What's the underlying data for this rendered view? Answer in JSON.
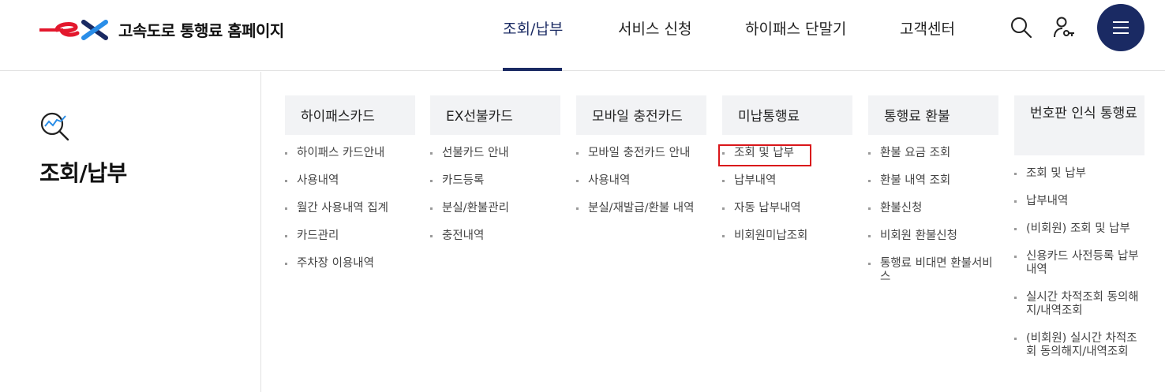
{
  "header": {
    "logo_text": "ex",
    "site_title": "고속도로 통행료 홈페이지",
    "nav": [
      "조회/납부",
      "서비스 신청",
      "하이패스 단말기",
      "고객센터"
    ],
    "active_nav": "조회/납부"
  },
  "icons": {
    "search": "search-icon",
    "user": "user-key-icon",
    "menu": "hamburger-menu-icon",
    "section": "magnifier-chart-icon"
  },
  "colors": {
    "brand_navy": "#1a2a63",
    "logo_red": "#e3182d",
    "highlight": "#d9161a"
  },
  "side": {
    "title": "조회/납부"
  },
  "columns": [
    {
      "title": "하이패스카드",
      "items": [
        "하이패스 카드안내",
        "사용내역",
        "월간 사용내역 집계",
        "카드관리",
        "주차장 이용내역"
      ]
    },
    {
      "title": "EX선불카드",
      "items": [
        "선불카드 안내",
        "카드등록",
        "분실/환불관리",
        "충전내역"
      ]
    },
    {
      "title": "모바일 충전카드",
      "items": [
        "모바일 충전카드 안내",
        "사용내역",
        "분실/재발급/환불 내역"
      ]
    },
    {
      "title": "미납통행료",
      "items": [
        "조회 및 납부",
        "납부내역",
        "자동 납부내역",
        "비회원미납조회"
      ]
    },
    {
      "title": "통행료 환불",
      "items": [
        "환불 요금 조회",
        "환불 내역 조회",
        "환불신청",
        "비회원 환불신청",
        "통행료 비대면 환불서비스"
      ]
    },
    {
      "title": "번호판 인식 통행료",
      "items": [
        "조회 및 납부",
        "납부내역",
        "(비회원) 조회 및 납부",
        "신용카드 사전등록 납부내역",
        "실시간 차적조회 동의해지/내역조회",
        "(비회원) 실시간 차적조회 동의해지/내역조회"
      ]
    }
  ]
}
